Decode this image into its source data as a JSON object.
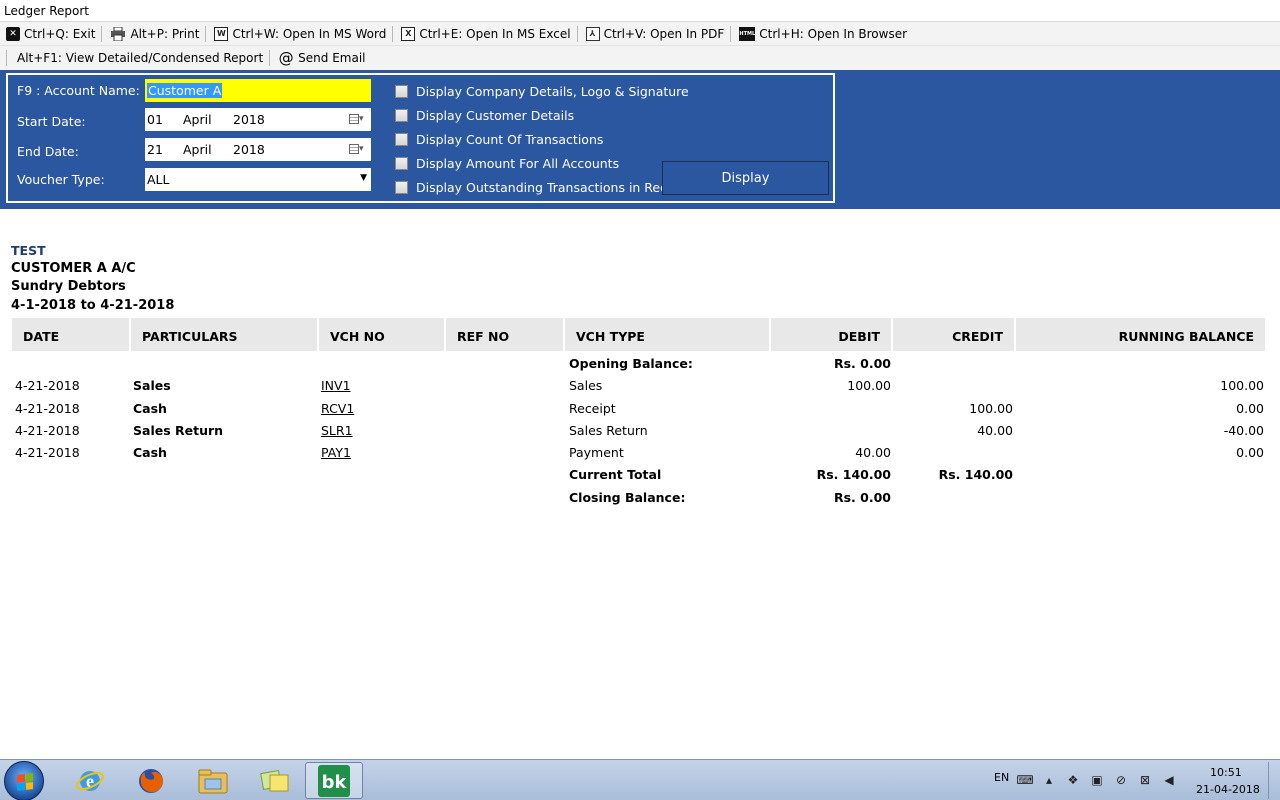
{
  "window": {
    "title": "Ledger Report"
  },
  "toolbar": {
    "exit": "Ctrl+Q: Exit",
    "print": "Alt+P: Print",
    "word": "Ctrl+W: Open In MS Word",
    "excel": "Ctrl+E: Open In MS Excel",
    "pdf": "Ctrl+V: Open In PDF",
    "browser": "Ctrl+H: Open In Browser",
    "view_toggle": "Alt+F1: View Detailed/Condensed Report",
    "send_email": "Send Email"
  },
  "filters": {
    "account_label": "F9 : Account Name:",
    "account_value": "Customer A",
    "start_label": "Start Date:",
    "start_day": "01",
    "start_month": "April",
    "start_year": "2018",
    "end_label": "End Date:",
    "end_day": "21",
    "end_month": "April",
    "end_year": "2018",
    "voucher_label": "Voucher Type:",
    "voucher_value": "ALL",
    "options": [
      {
        "label": "Display Company Details, Logo & Signature",
        "checked": false
      },
      {
        "label": "Display Customer Details",
        "checked": false
      },
      {
        "label": "Display Count Of Transactions",
        "checked": false
      },
      {
        "label": "Display Amount For All Accounts",
        "checked": false
      },
      {
        "label": "Display Outstanding Transactions in Red",
        "checked": false
      }
    ],
    "display_button": "Display"
  },
  "report": {
    "company": "TEST",
    "account": "CUSTOMER A A/C",
    "group": "Sundry Debtors",
    "period": "4-1-2018 to 4-21-2018",
    "columns": [
      "DATE",
      "PARTICULARS",
      "VCH NO",
      "REF NO",
      "VCH TYPE",
      "DEBIT",
      "CREDIT",
      "RUNNING BALANCE"
    ],
    "opening": {
      "label": "Opening Balance:",
      "debit": "Rs. 0.00"
    },
    "rows": [
      {
        "date": "4-21-2018",
        "particulars": "Sales",
        "vch_no": "INV1",
        "ref_no": "",
        "vch_type": "Sales",
        "debit": "100.00",
        "credit": "",
        "balance": "100.00"
      },
      {
        "date": "4-21-2018",
        "particulars": "Cash",
        "vch_no": "RCV1",
        "ref_no": "",
        "vch_type": "Receipt",
        "debit": "",
        "credit": "100.00",
        "balance": "0.00"
      },
      {
        "date": "4-21-2018",
        "particulars": "Sales Return",
        "vch_no": "SLR1",
        "ref_no": "",
        "vch_type": "Sales Return",
        "debit": "",
        "credit": "40.00",
        "balance": "-40.00"
      },
      {
        "date": "4-21-2018",
        "particulars": "Cash",
        "vch_no": "PAY1",
        "ref_no": "",
        "vch_type": "Payment",
        "debit": "40.00",
        "credit": "",
        "balance": "0.00"
      }
    ],
    "current_total": {
      "label": "Current Total",
      "debit": "Rs. 140.00",
      "credit": "Rs. 140.00"
    },
    "closing": {
      "label": "Closing Balance:",
      "debit": "Rs. 0.00"
    }
  },
  "taskbar": {
    "apps": [
      "ie-icon",
      "firefox-icon",
      "explorer-icon",
      "sticky-notes-icon",
      "bk-app-icon"
    ],
    "language": "EN",
    "time": "10:51",
    "date": "21-04-2018"
  }
}
